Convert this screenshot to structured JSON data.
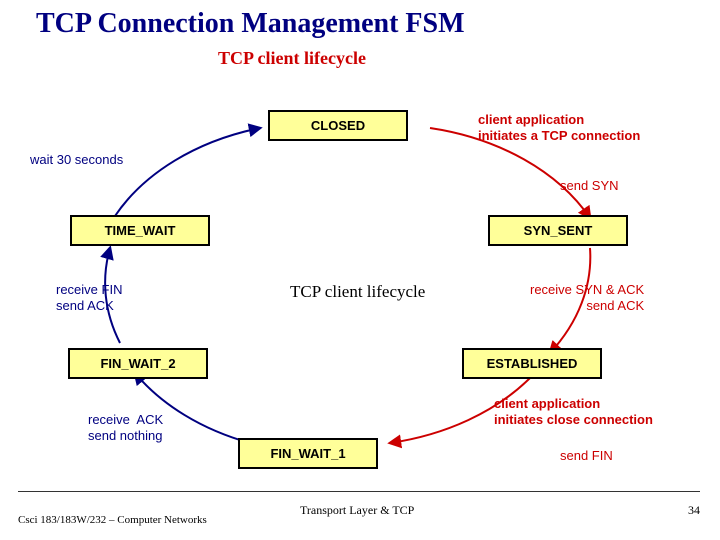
{
  "title": "TCP Connection Management FSM",
  "subtitle": "TCP client lifecycle",
  "states": {
    "closed": "CLOSED",
    "syn_sent": "SYN_SENT",
    "time_wait": "TIME_WAIT",
    "established": "ESTABLISHED",
    "fin_wait_2": "FIN_WAIT_2",
    "fin_wait_1": "FIN_WAIT_1"
  },
  "labels": {
    "client_initiates": "client application\ninitiates a TCP connection",
    "send_syn": "send SYN",
    "receive_syn_ack": "receive SYN & ACK\nsend ACK",
    "client_close": "client application\ninitiates close connection",
    "send_fin": "send FIN",
    "receive_ack": "receive  ACK\nsend nothing",
    "receive_fin": "receive FIN\nsend ACK",
    "wait_30": "wait 30 seconds",
    "center": "TCP client\nlifecycle"
  },
  "footer": {
    "left": "Csci 183/183W/232 – Computer Networks",
    "center": "Transport Layer &  TCP",
    "page": "34"
  }
}
